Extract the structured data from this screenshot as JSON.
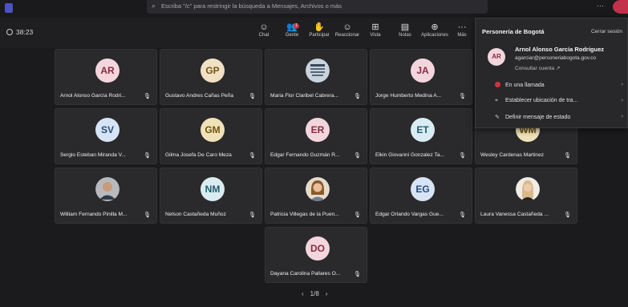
{
  "search": {
    "placeholder": "Escriba \"/c\" para restringir la búsqueda a Mensajes, Archivos o más"
  },
  "toolbar": {
    "timer": "38:23",
    "people_badge": "1",
    "buttons": [
      "Chat",
      "Gente",
      "Participar",
      "Reaccionar",
      "Vista",
      "Notas",
      "Aplicaciones",
      "Más"
    ]
  },
  "participants": [
    {
      "initials": "AR",
      "name": "Arnol Alonso García Rodri...",
      "color": "#f3d6dd",
      "fg": "#8a2b42"
    },
    {
      "initials": "GP",
      "name": "Gustavo Andres Cañas Peña",
      "color": "#f0e0c4",
      "fg": "#7a5418"
    },
    {
      "initials": "",
      "name": "Maria Flor Claribel Cabrera...",
      "photo": "badge"
    },
    {
      "initials": "JA",
      "name": "Jorge Humberto Medina A...",
      "color": "#f3d6dd",
      "fg": "#8a2b42"
    },
    {
      "initials": "SV",
      "name": "Sergio Esteban Miranda V...",
      "color": "#d6e4f5",
      "fg": "#2a4c7a"
    },
    {
      "initials": "GM",
      "name": "Gilma Josefa De Caro Meza",
      "color": "#f0e2b8",
      "fg": "#6f5310"
    },
    {
      "initials": "ER",
      "name": "Edgar Fernando Guzmán R...",
      "color": "#f3d6dd",
      "fg": "#8a2b42"
    },
    {
      "initials": "ET",
      "name": "Elkin Giovanni Gonzalez Ta...",
      "color": "#d9ecf2",
      "fg": "#1f5c6f"
    },
    {
      "initials": "WM",
      "name": "Wesley Cardenas Martinez",
      "color": "#f0e2b8",
      "fg": "#6f5310"
    },
    {
      "initials": "",
      "name": "William Fernando Pinilla M...",
      "photo": "man"
    },
    {
      "initials": "NM",
      "name": "Nelson Castañeda Muñoz",
      "color": "#d9ecf2",
      "fg": "#1f5c6f"
    },
    {
      "initials": "",
      "name": "Patricia Villegas de la Puen...",
      "photo": "woman"
    },
    {
      "initials": "EG",
      "name": "Edgar Orlando Vargas Gue...",
      "color": "#d6e4f5",
      "fg": "#2a4c7a"
    },
    {
      "initials": "",
      "name": "Laura Vanessa Castañeda ...",
      "photo": "woman2"
    },
    {
      "initials": "DO",
      "name": "Dayana Carolina Pallares O...",
      "color": "#f3d6dd",
      "fg": "#8a2b42"
    }
  ],
  "pager": {
    "label": "1/8"
  },
  "profile": {
    "org": "Personería de Bogotá",
    "signout": "Cerrar sesión",
    "initials": "AR",
    "name": "Arnol Alonso García Rodriguez",
    "email": "agarciar@personeriabogota.gov.co",
    "account_link": "Consultar cuenta",
    "status": "En una llamada",
    "location": "Establecer ubicación de tra...",
    "message": "Definir mensaje de estado"
  }
}
